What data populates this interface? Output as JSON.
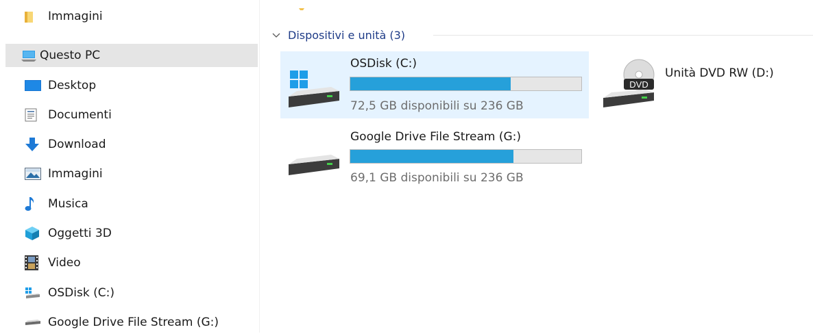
{
  "sidebar": {
    "items": [
      {
        "label": "Immagini",
        "icon": "folder-icon"
      },
      {
        "label": "Questo PC",
        "icon": "computer-icon",
        "selected": true
      },
      {
        "label": "Desktop",
        "icon": "desktop-icon"
      },
      {
        "label": "Documenti",
        "icon": "documents-icon"
      },
      {
        "label": "Download",
        "icon": "download-icon"
      },
      {
        "label": "Immagini",
        "icon": "pictures-icon"
      },
      {
        "label": "Musica",
        "icon": "music-icon"
      },
      {
        "label": "Oggetti 3D",
        "icon": "objects-3d-icon"
      },
      {
        "label": "Video",
        "icon": "video-icon"
      },
      {
        "label": "OSDisk (C:)",
        "icon": "windows-drive-icon"
      },
      {
        "label": "Google Drive File Stream (G:)",
        "icon": "drive-icon"
      }
    ]
  },
  "main": {
    "group_header": "Dispositivi e unità (3)",
    "drives": [
      {
        "name": "OSDisk (C:)",
        "free_text": "72,5 GB disponibili su 236 GB",
        "used_fraction": 0.693,
        "icon": "windows-drive-icon",
        "selected": true
      },
      {
        "name": "Google Drive File Stream (G:)",
        "free_text": "69,1 GB disponibili su 236 GB",
        "used_fraction": 0.707,
        "icon": "drive-icon"
      },
      {
        "name": "Unità DVD RW (D:)",
        "icon": "dvd-drive-icon",
        "dvd_label": "DVD"
      }
    ]
  },
  "colors": {
    "selection": "#e5f3ff",
    "sidebar_selected": "#e5e5e5",
    "bar_fill": "#26a0da",
    "header_text": "#1e3b87"
  }
}
